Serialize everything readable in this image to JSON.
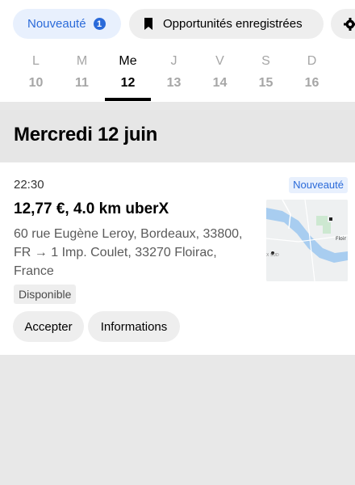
{
  "filters": {
    "new_label": "Nouveauté",
    "new_count": "1",
    "saved_label": "Opportunités enregistrées",
    "icons": [
      "bookmark-icon",
      "gear-icon"
    ]
  },
  "days": [
    {
      "letter": "L",
      "num": "10",
      "active": false
    },
    {
      "letter": "M",
      "num": "11",
      "active": false
    },
    {
      "letter": "Me",
      "num": "12",
      "active": true
    },
    {
      "letter": "J",
      "num": "13",
      "active": false
    },
    {
      "letter": "V",
      "num": "14",
      "active": false
    },
    {
      "letter": "S",
      "num": "15",
      "active": false
    },
    {
      "letter": "D",
      "num": "16",
      "active": false
    }
  ],
  "section": {
    "title": "Mercredi 12 juin"
  },
  "trip": {
    "time": "22:30",
    "tag": "Nouveauté",
    "fare": "12,77 €, 4.0 km uberX",
    "route": "60 rue Eugène Leroy, Bordeaux, 33800, FR → 1 Imp. Coulet, 33270 Floirac, France",
    "status": "Disponible",
    "accept_label": "Accepter",
    "info_label": "Informations",
    "map": {
      "label_floirac": "Floir",
      "label_south": "X SUD"
    }
  },
  "colors": {
    "accent": "#2a6ad9",
    "accent_bg": "#e8f0fd",
    "chip_bg": "#eeeeee",
    "page_bg": "#e8e8e8"
  }
}
